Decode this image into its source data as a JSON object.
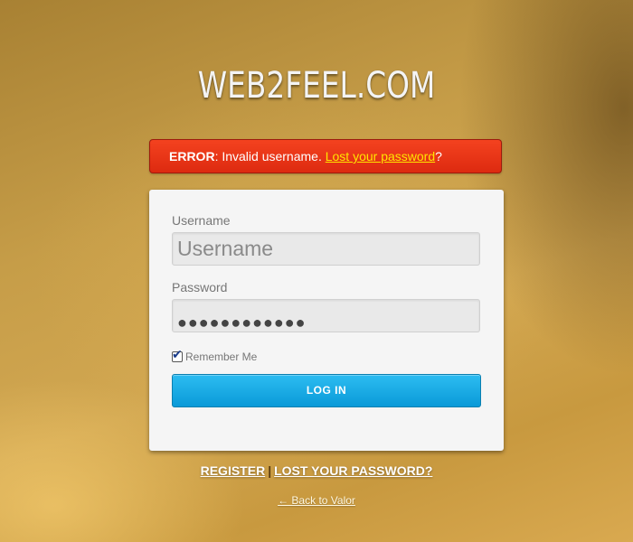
{
  "header": {
    "logo_text": "WEB2FEEL.COM"
  },
  "error": {
    "label": "ERROR",
    "message": ": Invalid username. ",
    "link_text": "Lost your password",
    "suffix": "?"
  },
  "form": {
    "username": {
      "label": "Username",
      "placeholder": "Username",
      "value": ""
    },
    "password": {
      "label": "Password",
      "masked_value": "●●●●●●●●●●●●"
    },
    "remember": {
      "label": "Remember Me",
      "checked": true,
      "check_glyph": "✔"
    },
    "submit_label": "LOG IN"
  },
  "footer": {
    "register_label": "REGISTER",
    "separator": "|",
    "lost_password_label": "LOST YOUR PASSWORD?",
    "back_link": "← Back to Valor"
  },
  "colors": {
    "error_bg": "#e83418",
    "error_link": "#ffe400",
    "button_bg": "#1aaae6",
    "card_bg": "#f5f5f5"
  }
}
